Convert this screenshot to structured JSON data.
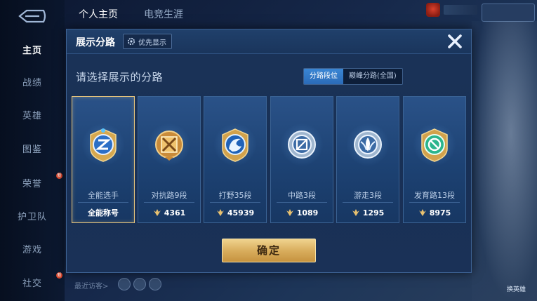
{
  "background": {
    "top_tabs": [
      "个人主页",
      "电竞生涯"
    ],
    "sidebar": [
      {
        "label": "主页",
        "active": true
      },
      {
        "label": "战绩",
        "active": false
      },
      {
        "label": "英雄",
        "active": false
      },
      {
        "label": "图鉴",
        "active": false
      },
      {
        "label": "荣誉",
        "active": false,
        "badge": "新"
      },
      {
        "label": "护卫队",
        "active": false
      },
      {
        "label": "游戏",
        "active": false
      },
      {
        "label": "社交",
        "active": false,
        "badge": "新"
      }
    ],
    "visitors_label": "最近访客>",
    "right_label": "换英雄"
  },
  "modal": {
    "title": "展示分路",
    "priority_label": "优先显示",
    "prompt": "请选择展示的分路",
    "tabs": [
      {
        "label": "分路段位",
        "active": true
      },
      {
        "label": "巅峰分路(全国)",
        "active": false
      }
    ],
    "cards": [
      {
        "name": "全能选手",
        "footer": "全能称号",
        "selected": true,
        "badge_color": "#4a9be8",
        "icon": "allround-emblem-icon"
      },
      {
        "name": "对抗路9段",
        "score": "4361",
        "selected": false,
        "badge_color": "#d8a04a",
        "icon": "clash-lane-emblem-icon"
      },
      {
        "name": "打野35段",
        "score": "45939",
        "selected": false,
        "badge_color": "#3d8de0",
        "icon": "jungle-emblem-icon"
      },
      {
        "name": "中路3段",
        "score": "1089",
        "selected": false,
        "badge_color": "#8fb7de",
        "icon": "mid-lane-emblem-icon"
      },
      {
        "name": "游走3段",
        "score": "1295",
        "selected": false,
        "badge_color": "#8fb7de",
        "icon": "roam-emblem-icon"
      },
      {
        "name": "发育路13段",
        "score": "8975",
        "selected": false,
        "badge_color": "#3fc8a0",
        "icon": "farm-lane-emblem-icon"
      }
    ],
    "confirm_label": "确定"
  }
}
